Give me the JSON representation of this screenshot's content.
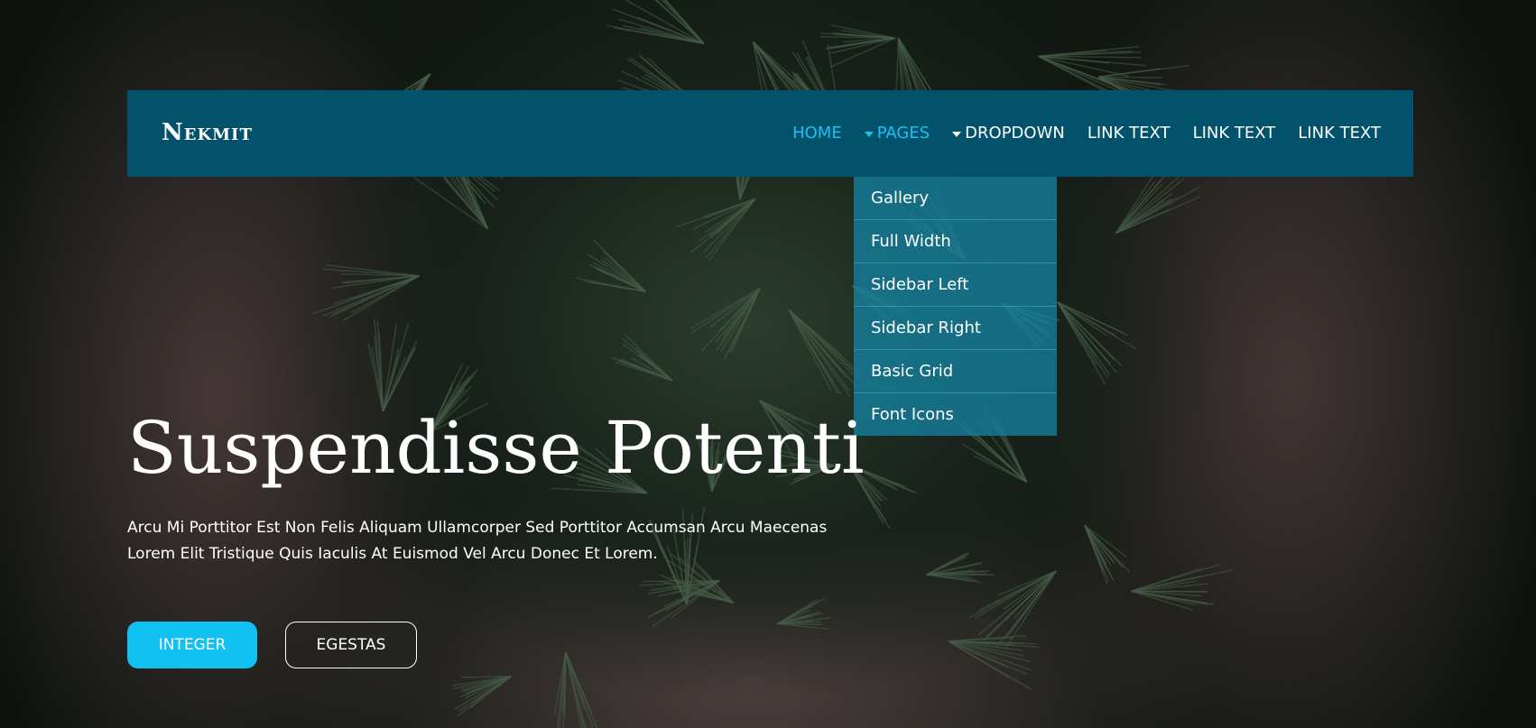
{
  "brand": {
    "name": "Nekmit"
  },
  "colors": {
    "navbar": "#03526b",
    "accent": "#1cc0f2",
    "button_primary": "#10c1f2",
    "dropdown": "#1482a0"
  },
  "nav": {
    "items": [
      {
        "label": "HOME",
        "active": true,
        "has_caret": false
      },
      {
        "label": "PAGES",
        "active": true,
        "has_caret": true
      },
      {
        "label": "DROPDOWN",
        "active": false,
        "has_caret": true
      },
      {
        "label": "LINK TEXT",
        "active": false,
        "has_caret": false
      },
      {
        "label": "LINK TEXT",
        "active": false,
        "has_caret": false
      },
      {
        "label": "LINK TEXT",
        "active": false,
        "has_caret": false
      }
    ]
  },
  "dropdown": {
    "items": [
      {
        "label": "Gallery"
      },
      {
        "label": "Full Width"
      },
      {
        "label": "Sidebar Left"
      },
      {
        "label": "Sidebar Right"
      },
      {
        "label": "Basic Grid"
      },
      {
        "label": "Font Icons"
      }
    ]
  },
  "hero": {
    "title": "Suspendisse Potenti",
    "text": "Arcu Mi Porttitor Est Non Felis Aliquam Ullamcorper Sed Porttitor Accumsan Arcu Maecenas Lorem Elit Tristique Quis Iaculis At Euismod Vel Arcu Donec Et Lorem.",
    "primary_button": "INTEGER",
    "secondary_button": "EGESTAS"
  }
}
